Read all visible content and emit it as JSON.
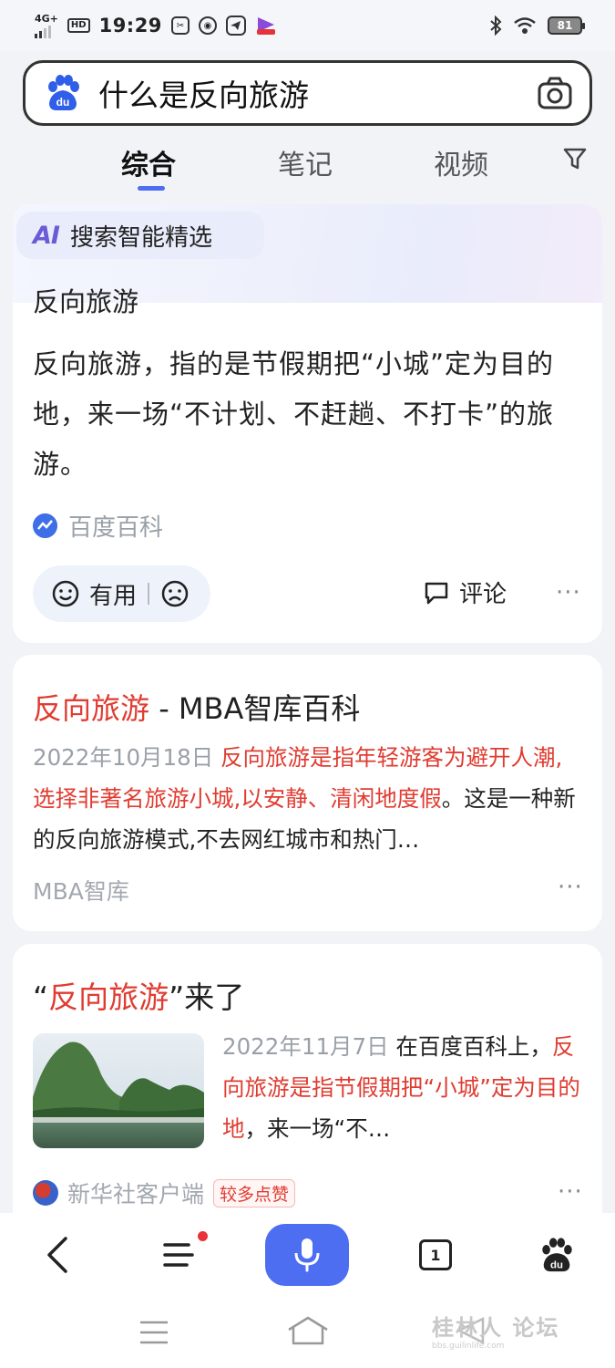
{
  "status_bar": {
    "network": "4G+",
    "hd": "HD",
    "time": "19:29",
    "battery": "81",
    "notification_icons": [
      "scissors-app-icon",
      "browser-app-icon",
      "telegram-icon",
      "video-app-icon"
    ],
    "right_icons": [
      "bluetooth-icon",
      "wifi-icon"
    ]
  },
  "search": {
    "query": "什么是反向旅游",
    "logo": "du",
    "camera_icon": "camera-icon"
  },
  "tabs": [
    {
      "label": "综合",
      "active": true
    },
    {
      "label": "笔记",
      "active": false
    },
    {
      "label": "视频",
      "active": false
    }
  ],
  "ai_card": {
    "badge_logo": "AI",
    "badge_title": "搜索智能精选",
    "heading": "反向旅游",
    "body": "反向旅游，指的是节假期把“小城”定为目的地，来一场“不计划、不赶趟、不打卡”的旅游。",
    "source": "百度百科",
    "feedback_label": "有用",
    "comment_label": "评论",
    "more": "···"
  },
  "result_mba": {
    "title_highlight": "反向旅游",
    "title_rest": " - MBA智库百科",
    "date": "2022年10月18日",
    "snippet_highlight": "反向旅游是指年轻游客为避开人潮,选择非著名旅游小城,以安静、清闲地度假",
    "snippet_rest": "。这是一种新的反向旅游模式,不去网红城市和热门…",
    "source": "MBA智库",
    "more": "···"
  },
  "result_news": {
    "title_open": "“",
    "title_highlight": "反向旅游",
    "title_rest": "”来了",
    "date": "2022年11月7日",
    "snippet_lead": " 在百度百科上，",
    "snippet_highlight": "反向旅游是指节假期把“小城”定为目的地",
    "snippet_rest": "，来一场“不…",
    "source": "新华社客户端",
    "badge": "较多点赞",
    "more": "···"
  },
  "toolbar": {
    "tab_count": "1",
    "mic_color": "#4e6ef2"
  },
  "colors": {
    "accent": "#4e6ef2",
    "highlight": "#e03c31",
    "muted": "#9aa0a8"
  },
  "watermark": {
    "text": "桂林人 论坛",
    "sub": "bbs.guilinlife.com"
  }
}
